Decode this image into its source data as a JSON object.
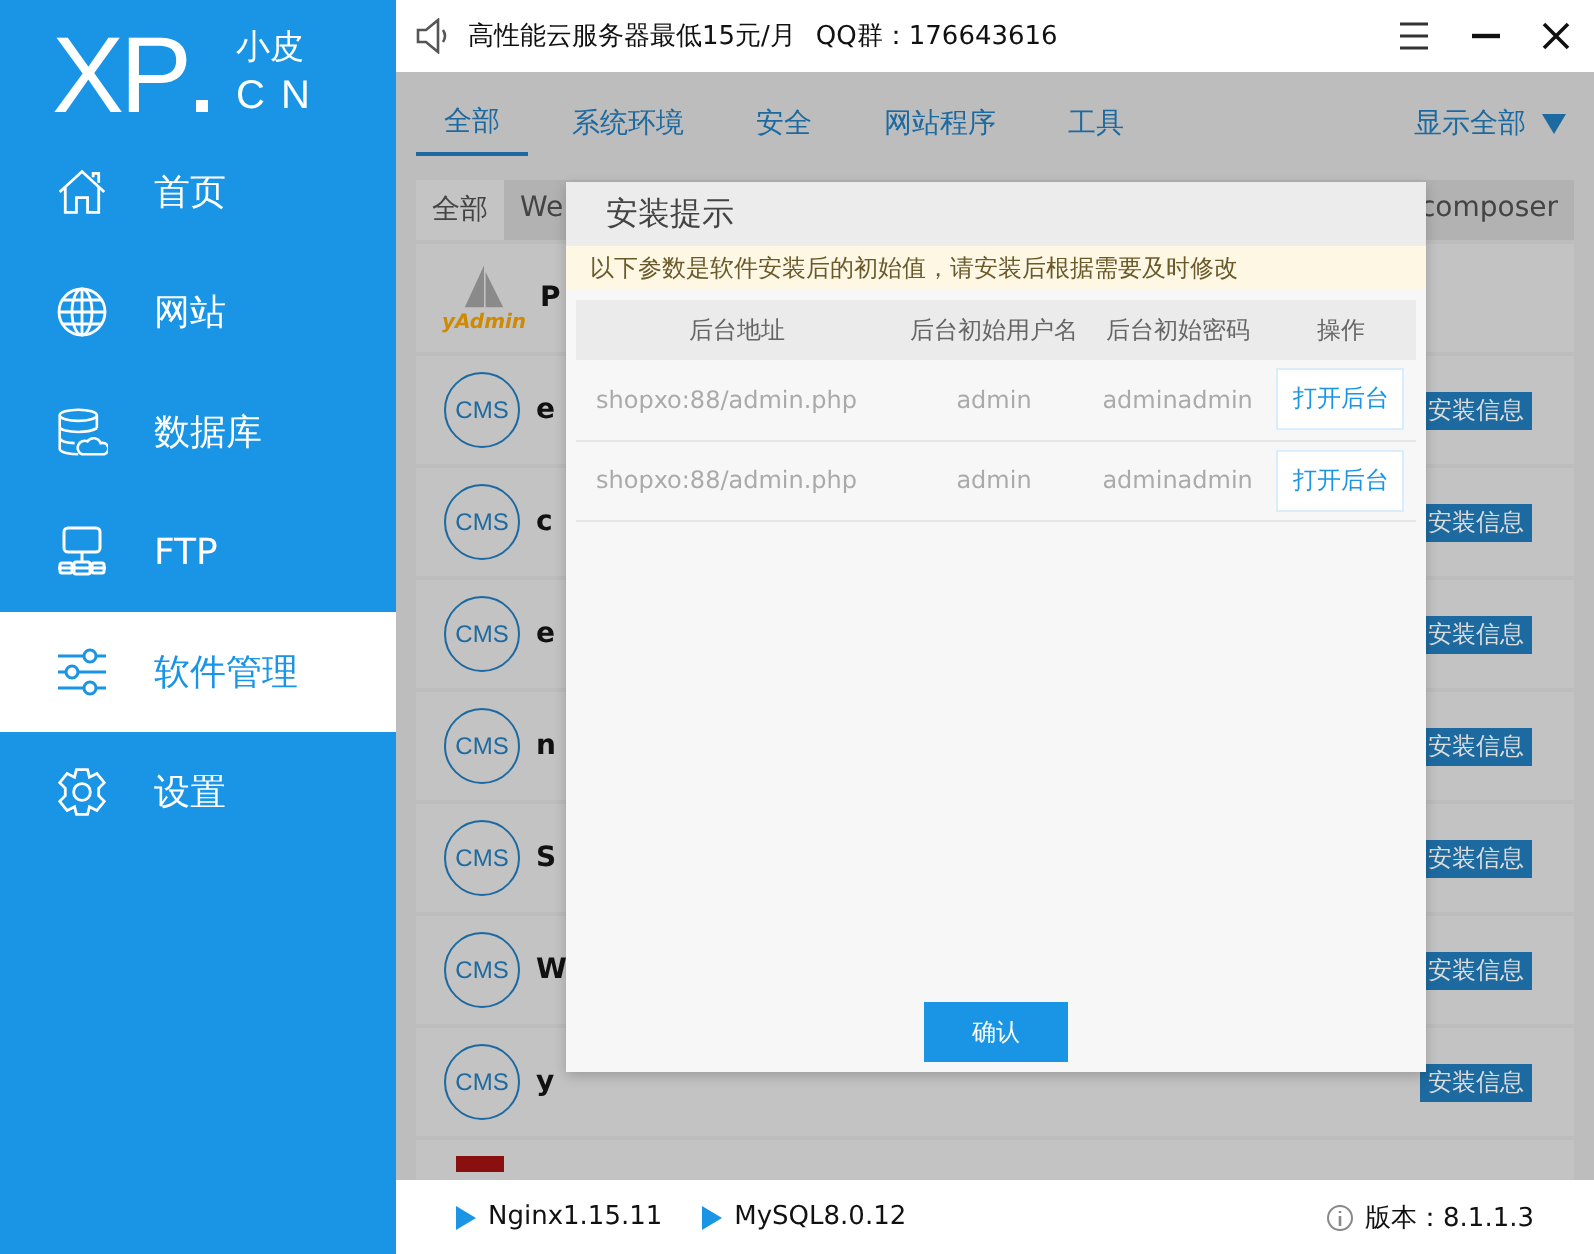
{
  "logo": {
    "mark": "XP",
    "sub_top": "小皮",
    "sub_bottom": "CN"
  },
  "sidebar": {
    "items": [
      {
        "label": "首页",
        "selected": false
      },
      {
        "label": "网站",
        "selected": false
      },
      {
        "label": "数据库",
        "selected": false
      },
      {
        "label": "FTP",
        "selected": false
      },
      {
        "label": "软件管理",
        "selected": true
      },
      {
        "label": "设置",
        "selected": false
      }
    ]
  },
  "top_bar": {
    "promo": "高性能云服务器最低15元/月",
    "qq": "QQ群：176643616"
  },
  "category_tabs": [
    {
      "label": "全部",
      "selected": true
    },
    {
      "label": "系统环境",
      "selected": false
    },
    {
      "label": "安全",
      "selected": false
    },
    {
      "label": "网站程序",
      "selected": false
    },
    {
      "label": "工具",
      "selected": false
    }
  ],
  "show_all": "显示全部",
  "sub_tabs": [
    {
      "label": "全部",
      "selected": true
    },
    {
      "label": "We",
      "selected": false
    },
    {
      "label": "composer",
      "selected": false
    }
  ],
  "software_rows": [
    {
      "kind": "yadmin",
      "logo_text": "yAdmin",
      "name": "P"
    },
    {
      "kind": "cms",
      "logo_text": "CMS",
      "name": "e",
      "action": "安装信息"
    },
    {
      "kind": "cms",
      "logo_text": "CMS",
      "name": "c",
      "action": "安装信息"
    },
    {
      "kind": "cms",
      "logo_text": "CMS",
      "name": "e",
      "action": "安装信息"
    },
    {
      "kind": "cms",
      "logo_text": "CMS",
      "name": "n",
      "action": "安装信息"
    },
    {
      "kind": "cms",
      "logo_text": "CMS",
      "name": "S",
      "action": "安装信息"
    },
    {
      "kind": "cms",
      "logo_text": "CMS",
      "name": "W",
      "action": "安装信息"
    },
    {
      "kind": "cms",
      "logo_text": "CMS",
      "name": "y",
      "action": "安装信息"
    },
    {
      "kind": "red"
    }
  ],
  "dialog": {
    "title": "安装提示",
    "notice": "以下参数是软件安装后的初始值，请安装后根据需要及时修改",
    "columns": [
      "后台地址",
      "后台初始用户名",
      "后台初始密码",
      "操作"
    ],
    "rows": [
      {
        "address": "shopxo:88/admin.php",
        "username": "admin",
        "password": "adminadmin",
        "action": "打开后台"
      },
      {
        "address": "shopxo:88/admin.php",
        "username": "admin",
        "password": "adminadmin",
        "action": "打开后台"
      }
    ],
    "confirm": "确认"
  },
  "status_bar": {
    "services": [
      "Nginx1.15.11",
      "MySQL8.0.12"
    ],
    "version": "版本：8.1.1.3"
  }
}
